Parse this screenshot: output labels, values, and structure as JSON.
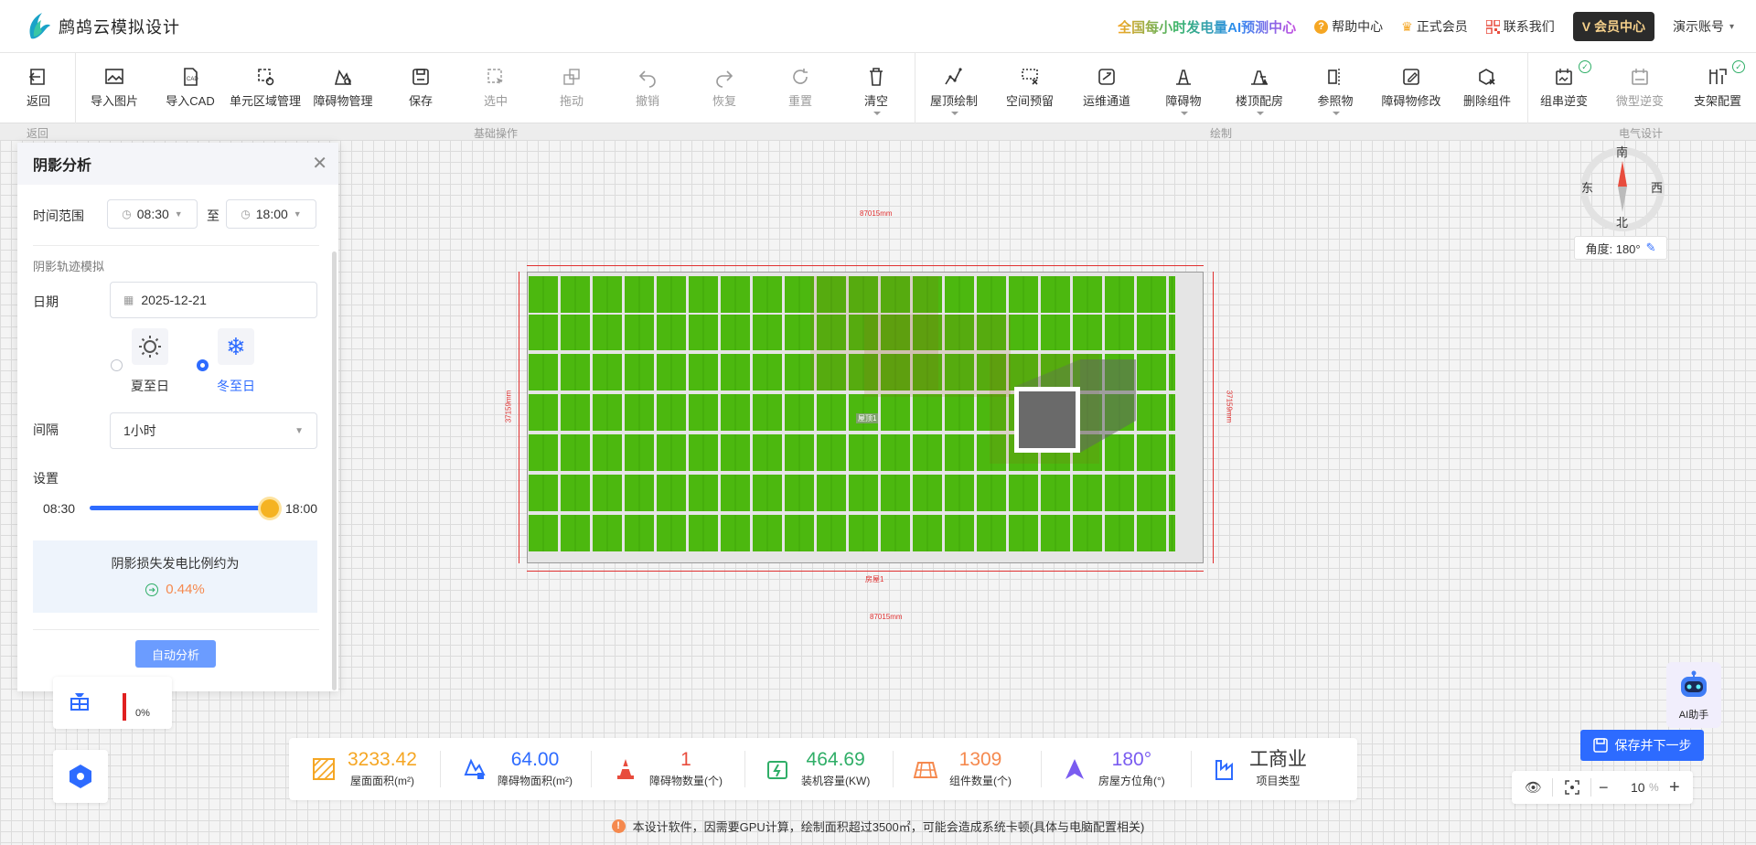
{
  "header": {
    "app_name": "鹧鸪云模拟设计",
    "promo": "全国每小时发电量AI预测中心",
    "help": "帮助中心",
    "member": "正式会员",
    "contact": "联系我们",
    "member_center": "会员中心",
    "account": "演示账号"
  },
  "toolbar": {
    "tools": [
      {
        "label": "返回",
        "icon": "back-icon"
      },
      {
        "label": "导入图片",
        "icon": "image-import-icon"
      },
      {
        "label": "导入CAD",
        "icon": "cad-import-icon"
      },
      {
        "label": "单元区域管理",
        "icon": "area-manage-icon"
      },
      {
        "label": "障碍物管理",
        "icon": "obstacle-manage-icon"
      },
      {
        "label": "保存",
        "icon": "save-icon"
      },
      {
        "label": "选中",
        "icon": "select-icon"
      },
      {
        "label": "拖动",
        "icon": "drag-icon"
      },
      {
        "label": "撤销",
        "icon": "undo-icon"
      },
      {
        "label": "恢复",
        "icon": "redo-icon"
      },
      {
        "label": "重置",
        "icon": "reset-icon"
      },
      {
        "label": "清空",
        "icon": "trash-icon"
      },
      {
        "label": "屋顶绘制",
        "icon": "roof-draw-icon"
      },
      {
        "label": "空间预留",
        "icon": "space-reserve-icon"
      },
      {
        "label": "运维通道",
        "icon": "maintenance-channel-icon"
      },
      {
        "label": "障碍物",
        "icon": "obstacle-icon"
      },
      {
        "label": "楼顶配房",
        "icon": "rooftop-room-icon"
      },
      {
        "label": "参照物",
        "icon": "reference-icon"
      },
      {
        "label": "障碍物修改",
        "icon": "obstacle-edit-icon"
      },
      {
        "label": "删除组件",
        "icon": "delete-component-icon"
      },
      {
        "label": "组串逆变",
        "icon": "string-inverter-icon"
      },
      {
        "label": "微型逆变",
        "icon": "micro-inverter-icon"
      },
      {
        "label": "支架配置",
        "icon": "bracket-config-icon"
      }
    ],
    "groups": {
      "back": "返回",
      "basic": "基础操作",
      "draw": "绘制",
      "electrical": "电气设计"
    }
  },
  "shadow_panel": {
    "title": "阴影分析",
    "time_range_label": "时间范围",
    "time_start": "08:30",
    "time_sep": "至",
    "time_end": "18:00",
    "track_title": "阴影轨迹模拟",
    "date_label": "日期",
    "date_value": "2025-12-21",
    "summer": "夏至日",
    "winter": "冬至日",
    "interval_label": "间隔",
    "interval_value": "1小时",
    "settings_label": "设置",
    "slider_min": "08:30",
    "slider_max": "18:00",
    "slider_value": 1.0,
    "loss_title": "阴影损失发电比例约为",
    "loss_value": "0.44%",
    "auto_button": "自动分析"
  },
  "drawing": {
    "dim_top": "87015mm",
    "dim_bottom": "87015mm",
    "dim_left": "37159mm",
    "dim_right": "37159mm",
    "roof_name": "房屋1",
    "center_label": "屋顶1",
    "panel_color": "#4cb80f"
  },
  "compass": {
    "south": "南",
    "north": "北",
    "east": "东",
    "west": "西",
    "angle_text": "角度: 180°"
  },
  "side": {
    "percent": "0%"
  },
  "stats": [
    {
      "value": "3233.42",
      "label": "屋面面积(m²)",
      "color": "#f5a623",
      "icon": "roof-area-icon"
    },
    {
      "value": "64.00",
      "label": "障碍物面积(m²)",
      "color": "#2d6bff",
      "icon": "obstacle-area-icon"
    },
    {
      "value": "1",
      "label": "障碍物数量(个)",
      "color": "#e84c3d",
      "icon": "cone-icon"
    },
    {
      "value": "464.69",
      "label": "装机容量(KW)",
      "color": "#2fae67",
      "icon": "battery-icon"
    },
    {
      "value": "1309",
      "label": "组件数量(个)",
      "color": "#f5894e",
      "icon": "panel-grid-icon"
    },
    {
      "value": "180°",
      "label": "房屋方位角(°)",
      "color": "#7a5cf0",
      "icon": "azimuth-icon"
    },
    {
      "value": "工商业",
      "label": "项目类型",
      "color": "#333333",
      "icon": "factory-icon"
    }
  ],
  "zoom": {
    "value": "10",
    "unit": "%"
  },
  "save_next": "保存并下一步",
  "ai_helper": "AI助手",
  "notice": "本设计软件，因需要GPU计算，绘制面积超过3500㎡，可能会造成系统卡顿(具体与电脑配置相关)"
}
